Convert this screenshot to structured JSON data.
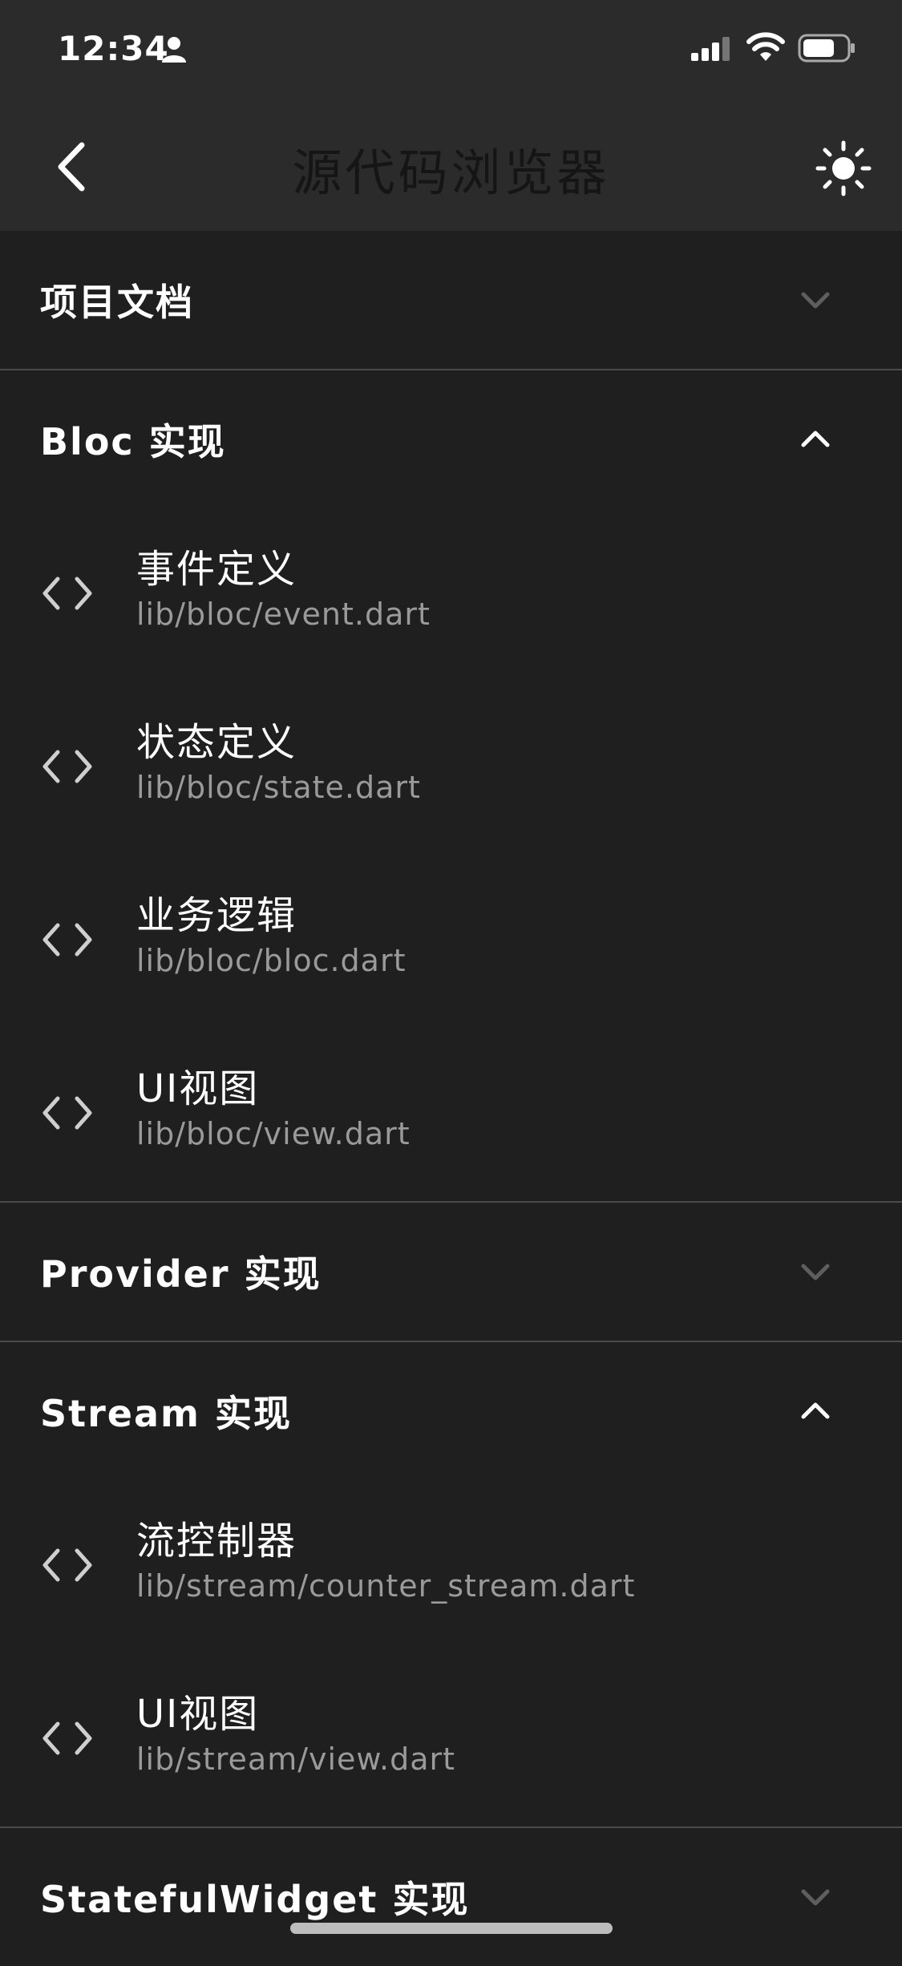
{
  "status_bar": {
    "time": "12:34",
    "icons": [
      "person-icon",
      "signal-icon",
      "wifi-icon",
      "battery-icon"
    ]
  },
  "app_bar": {
    "title": "源代码浏览器",
    "back_icon": "chevron-left-icon",
    "theme_icon": "sun-icon"
  },
  "sections": [
    {
      "title": "项目文档",
      "expanded": false,
      "items": []
    },
    {
      "title": "Bloc 实现",
      "expanded": true,
      "items": [
        {
          "title": "事件定义",
          "path": "lib/bloc/event.dart"
        },
        {
          "title": "状态定义",
          "path": "lib/bloc/state.dart"
        },
        {
          "title": "业务逻辑",
          "path": "lib/bloc/bloc.dart"
        },
        {
          "title": "UI视图",
          "path": "lib/bloc/view.dart"
        }
      ]
    },
    {
      "title": "Provider 实现",
      "expanded": false,
      "items": []
    },
    {
      "title": "Stream 实现",
      "expanded": true,
      "items": [
        {
          "title": "流控制器",
          "path": "lib/stream/counter_stream.dart"
        },
        {
          "title": "UI视图",
          "path": "lib/stream/view.dart"
        }
      ]
    },
    {
      "title": "StatefulWidget 实现",
      "expanded": false,
      "items": []
    }
  ],
  "colors": {
    "background": "#1f1f1f",
    "app_bar": "#2b2b2b",
    "divider": "#4a4a4a",
    "secondary_text": "#9a9a9a"
  }
}
